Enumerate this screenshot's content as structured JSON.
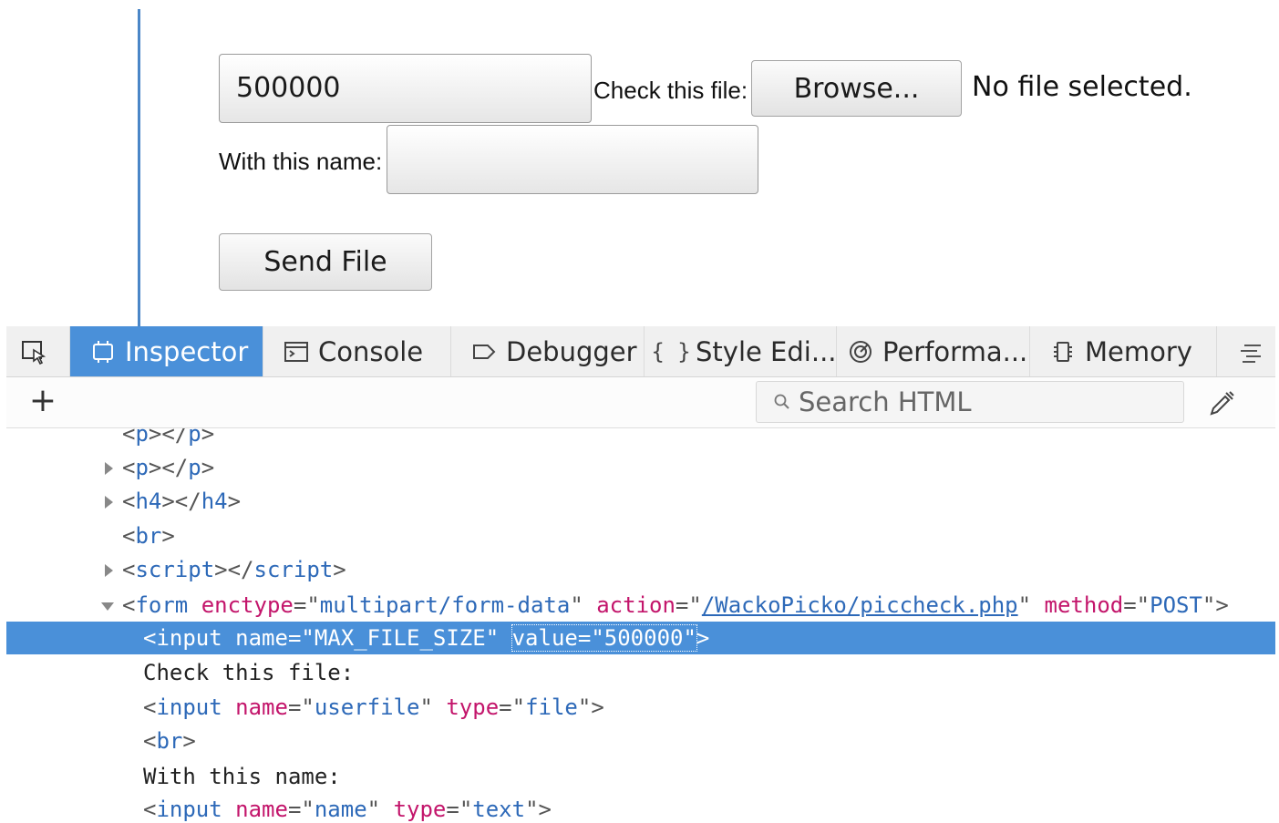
{
  "form": {
    "max_file_size_value": "500000",
    "check_file_label": "Check this file:",
    "browse_label": "Browse...",
    "no_file_text": "No file selected.",
    "name_label": "With this name:",
    "name_value": "",
    "send_label": "Send File"
  },
  "devtools": {
    "tabs": [
      {
        "label": "Inspector",
        "icon": "inspector-icon",
        "active": true
      },
      {
        "label": "Console",
        "icon": "console-icon"
      },
      {
        "label": "Debugger",
        "icon": "debugger-icon"
      },
      {
        "label": "Style Edi...",
        "icon": "style-editor-icon"
      },
      {
        "label": "Performa...",
        "icon": "performance-icon"
      },
      {
        "label": "Memory",
        "icon": "memory-icon"
      }
    ],
    "search_placeholder": "Search HTML",
    "accent_color": "#4a90d9"
  },
  "markup": {
    "l0": {
      "open": "<",
      "tag": "p",
      "mid": "></",
      "tag2": "p",
      "close": ">"
    },
    "l1": {
      "open": "<",
      "tag": "p",
      "mid": "></",
      "tag2": "p",
      "close": ">"
    },
    "l2": {
      "open": "<",
      "tag": "h4",
      "mid": "></",
      "tag2": "h4",
      "close": ">"
    },
    "l3": {
      "open": "<",
      "tag": "br",
      "close": ">"
    },
    "l4": {
      "open": "<",
      "tag": "script",
      "mid": "></",
      "tag2": "script",
      "close": ">"
    },
    "l5": {
      "open": "<",
      "tag": "form",
      "a1": "enctype",
      "eq": "=",
      "q": "\"",
      "v1": "multipart/form-data",
      "a2": "action",
      "v2": "/WackoPicko/piccheck.php",
      "a3": "method",
      "v3": "POST",
      "close": ">"
    },
    "l6": {
      "open": "<",
      "tag": "input",
      "a1": "name",
      "eq": "=",
      "q": "\"",
      "v1": "MAX_FILE_SIZE",
      "a2": "value",
      "v2": "500000",
      "close": ">"
    },
    "l7": {
      "text": "Check this file:"
    },
    "l8": {
      "open": "<",
      "tag": "input",
      "a1": "name",
      "eq": "=",
      "q": "\"",
      "v1": "userfile",
      "a2": "type",
      "v2": "file",
      "close": ">"
    },
    "l9": {
      "open": "<",
      "tag": "br",
      "close": ">"
    },
    "l10": {
      "text": "With this name:"
    },
    "l11": {
      "open": "<",
      "tag": "input",
      "a1": "name",
      "eq": "=",
      "q": "\"",
      "v1": "name",
      "a2": "type",
      "v2": "text",
      "close": ">"
    }
  }
}
